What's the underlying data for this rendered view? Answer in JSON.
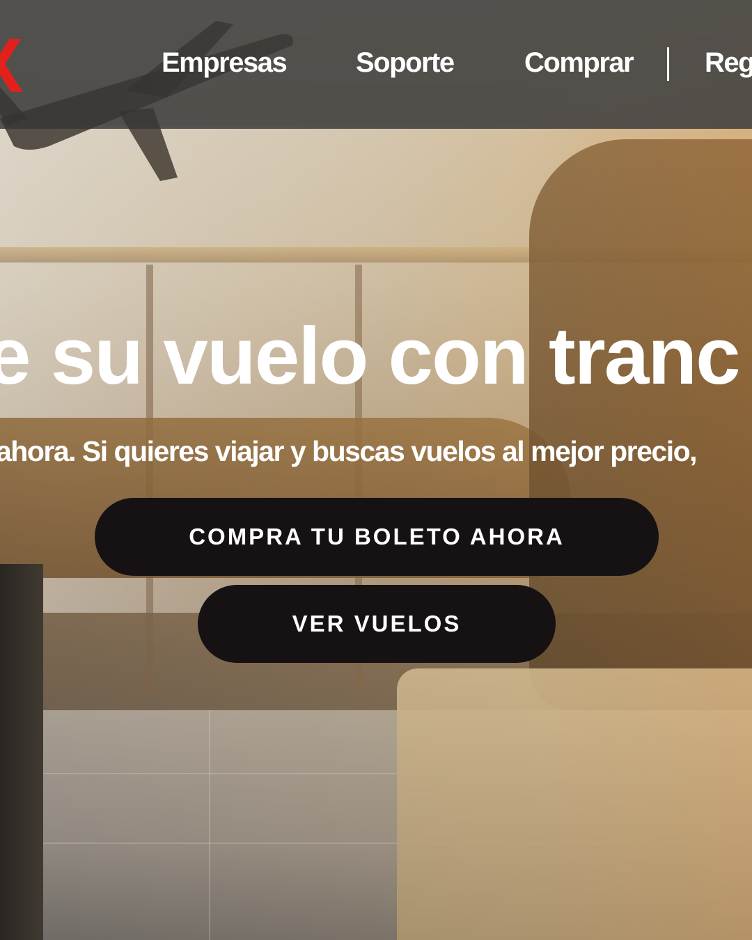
{
  "header": {
    "logo_text": "X",
    "nav": [
      {
        "label": "Empresas"
      },
      {
        "label": "Soporte"
      },
      {
        "label": "Comprar"
      },
      {
        "label": "Reg"
      }
    ]
  },
  "hero": {
    "title": "e su vuelo con tranc",
    "subtitle": "ahora. Si quieres viajar y buscas vuelos al mejor precio,",
    "primary_button": "COMPRA TU BOLETO AHORA",
    "secondary_button": "VER VUELOS"
  },
  "colors": {
    "brand_red": "#e3201b",
    "button_bg": "#161214",
    "header_bg": "#373737"
  }
}
